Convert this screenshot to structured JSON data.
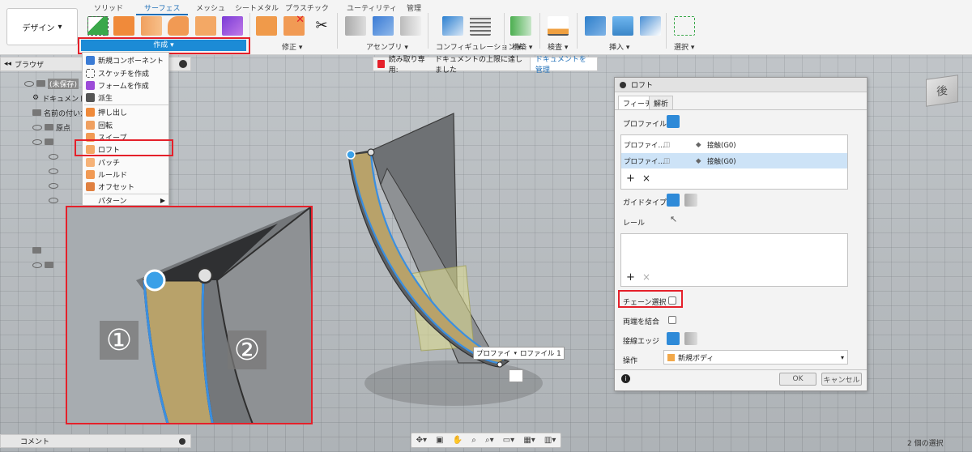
{
  "toolbar": {
    "design_label": "デザイン",
    "tabs": [
      "ソリッド",
      "サーフェス",
      "メッシュ",
      "シートメタル",
      "プラスチック",
      "ユーティリティ",
      "管理"
    ],
    "active_tab": "サーフェス",
    "groups": [
      "作成",
      "修正",
      "アセンブリ",
      "コンフィギュレーション",
      "構築",
      "検査",
      "挿入",
      "選択"
    ]
  },
  "create_menu": {
    "items": [
      "新規コンポーネント",
      "スケッチを作成",
      "フォームを作成",
      "派生",
      "押し出し",
      "回転",
      "スイープ",
      "ロフト",
      "パッチ",
      "ルールド",
      "オフセット",
      "パターン"
    ],
    "highlighted": "ロフト"
  },
  "browser": {
    "title": "ブラウザ",
    "rows": [
      "(未保存)",
      "ドキュメント設定",
      "名前の付いたビュー",
      "原点"
    ]
  },
  "readonly": {
    "label": "読み取り専用:",
    "message": "ドキュメントの上限に達しました",
    "manage": "ドキュメントを管理"
  },
  "loft_dialog": {
    "title": "ロフト",
    "tabs": [
      "フィーチャ",
      "解析"
    ],
    "profile_label": "プロファイル",
    "profiles": [
      {
        "name": "プロファイ...",
        "condition": "接触(G0)"
      },
      {
        "name": "プロファイ...",
        "condition": "接触(G0)"
      }
    ],
    "guide_type_label": "ガイドタイプ",
    "rail_label": "レール",
    "chain_select_label": "チェーン選択",
    "close_ends_label": "両端を結合",
    "tangent_edges_label": "接線エッジ",
    "operation_label": "操作",
    "operation_value": "新規ボディ",
    "ok_label": "OK",
    "cancel_label": "キャンセル",
    "add_sym": "+",
    "remove_sym": "×"
  },
  "viewport": {
    "viewcube_label": "後",
    "profile_tag": "プロファイ",
    "profile_tag2": "ロファイル 1",
    "badges": [
      "①",
      "②"
    ]
  },
  "bottom": {
    "comment_label": "コメント",
    "status": "2 個の選択"
  },
  "colors": {
    "accent": "#1c8bd6",
    "highlight_red": "#e5202a",
    "selected_row": "#cde3f7",
    "loft_fill": "#b8a26a"
  }
}
